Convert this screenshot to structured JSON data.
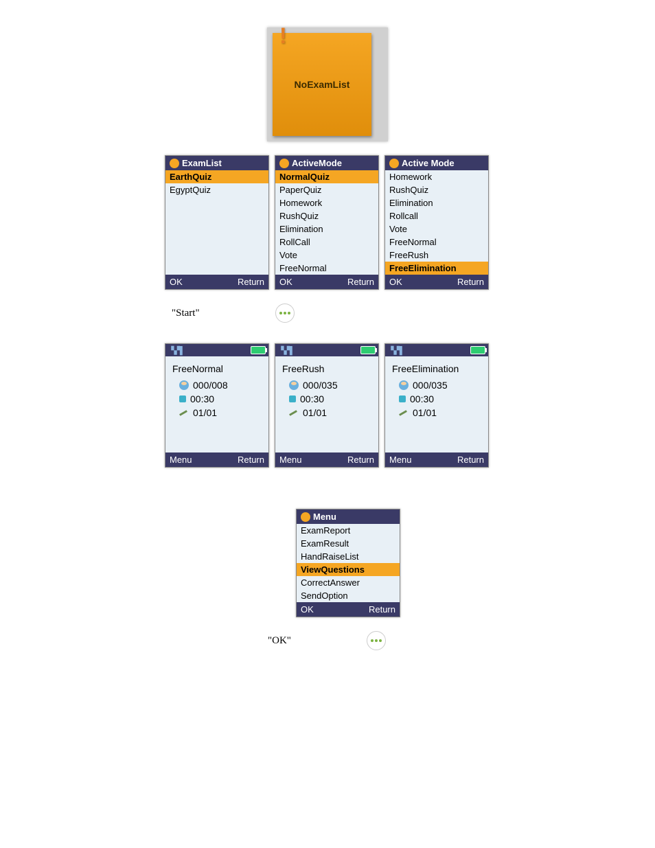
{
  "note": {
    "text": "NoExamList",
    "symbol": "!"
  },
  "phones_row1": [
    {
      "title": "ExamList",
      "items": [
        {
          "label": "EarthQuiz",
          "selected": true
        },
        {
          "label": "EgyptQuiz",
          "selected": false
        }
      ],
      "left": "OK",
      "right": "Return"
    },
    {
      "title": "ActiveMode",
      "items": [
        {
          "label": "NormalQuiz",
          "selected": true
        },
        {
          "label": "PaperQuiz",
          "selected": false
        },
        {
          "label": "Homework",
          "selected": false
        },
        {
          "label": "RushQuiz",
          "selected": false
        },
        {
          "label": "Elimination",
          "selected": false
        },
        {
          "label": "RollCall",
          "selected": false
        },
        {
          "label": "Vote",
          "selected": false
        },
        {
          "label": "FreeNormal",
          "selected": false
        }
      ],
      "left": "OK",
      "right": "Return"
    },
    {
      "title": "Active Mode",
      "items": [
        {
          "label": "Homework",
          "selected": false
        },
        {
          "label": "RushQuiz",
          "selected": false
        },
        {
          "label": "Elimination",
          "selected": false
        },
        {
          "label": "Rollcall",
          "selected": false
        },
        {
          "label": "Vote",
          "selected": false
        },
        {
          "label": "FreeNormal",
          "selected": false
        },
        {
          "label": "FreeRush",
          "selected": false
        },
        {
          "label": "FreeElimination",
          "selected": true
        }
      ],
      "left": "OK",
      "right": "Return"
    }
  ],
  "start_label": "\"Start\"",
  "phones_row2": [
    {
      "title": "FreeNormal",
      "count": "000/008",
      "time": "00:30",
      "progress": "01/01",
      "left": "Menu",
      "right": "Return"
    },
    {
      "title": "FreeRush",
      "count": "000/035",
      "time": "00:30",
      "progress": "01/01",
      "left": "Menu",
      "right": "Return"
    },
    {
      "title": "FreeElimination",
      "count": "000/035",
      "time": "00:30",
      "progress": "01/01",
      "left": "Menu",
      "right": "Return"
    }
  ],
  "menu_phone": {
    "title": "Menu",
    "items": [
      {
        "label": "ExamReport",
        "selected": false
      },
      {
        "label": "ExamResult",
        "selected": false
      },
      {
        "label": "HandRaiseList",
        "selected": false
      },
      {
        "label": "ViewQuestions",
        "selected": true
      },
      {
        "label": "CorrectAnswer",
        "selected": false
      },
      {
        "label": "SendOption",
        "selected": false
      }
    ],
    "left": "OK",
    "right": "Return"
  },
  "ok_label": "\"OK\"",
  "link_text": ""
}
